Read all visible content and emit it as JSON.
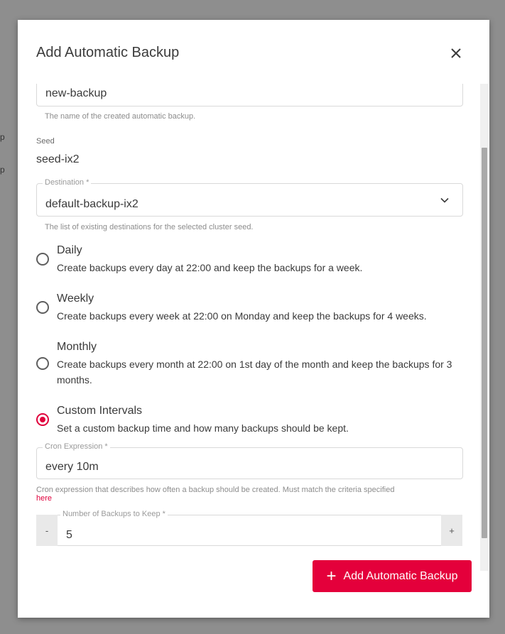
{
  "dialog": {
    "title": "Add Automatic Backup",
    "name_field": {
      "value": "new-backup",
      "hint": "The name of the created automatic backup."
    },
    "seed": {
      "label": "Seed",
      "value": "seed-ix2"
    },
    "destination": {
      "label": "Destination *",
      "value": "default-backup-ix2",
      "hint": "The list of existing destinations for the selected cluster seed."
    },
    "schedule_options": [
      {
        "title": "Daily",
        "description": "Create backups every day at 22:00 and keep the backups for a week.",
        "checked": false
      },
      {
        "title": "Weekly",
        "description": "Create backups every week at 22:00 on Monday and keep the backups for 4 weeks.",
        "checked": false
      },
      {
        "title": "Monthly",
        "description": "Create backups every month at 22:00 on 1st day of the month and keep the backups for 3 months.",
        "checked": false
      },
      {
        "title": "Custom Intervals",
        "description": "Set a custom backup time and how many backups should be kept.",
        "checked": true
      }
    ],
    "cron": {
      "label": "Cron Expression *",
      "value": "every 10m",
      "hint": "Cron expression that describes how often a backup should be created. Must match the criteria specified",
      "hint_link": "here"
    },
    "keep": {
      "label": "Number of Backups to Keep *",
      "value": "5",
      "minus": "-",
      "plus": "+"
    },
    "submit_label": "Add Automatic Backup",
    "submit_plus": "+"
  },
  "backdrop": {
    "glyph_a": "p",
    "glyph_b": "p"
  },
  "colors": {
    "accent": "#e4003b"
  }
}
